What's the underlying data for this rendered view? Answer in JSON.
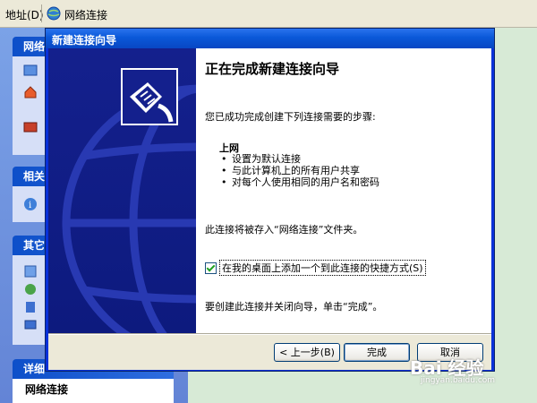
{
  "address_bar": {
    "label": "地址(D)",
    "value": "网络连接"
  },
  "task_pane": {
    "sections": [
      {
        "title": "网络"
      },
      {
        "title": "相关"
      },
      {
        "title": "其它"
      },
      {
        "title": "详细"
      }
    ],
    "details_value": "网络连接"
  },
  "wizard": {
    "title": "新建连接向导",
    "heading": "正在完成新建连接向导",
    "intro": "您已成功完成创建下列连接需要的步骤:",
    "connection_name": "上网",
    "bullets": [
      "设置为默认连接",
      "与此计算机上的所有用户共享",
      "对每个人使用相同的用户名和密码"
    ],
    "stored_text": "此连接将被存入“网络连接”文件夹。",
    "shortcut_checkbox": {
      "label": "在我的桌面上添加一个到此连接的快捷方式(S)",
      "checked": true
    },
    "finish_hint": "要创建此连接并关闭向导，单击“完成”。",
    "buttons": {
      "back": "< 上一步(B)",
      "finish": "完成",
      "cancel": "取消"
    }
  },
  "watermark": {
    "text": "Bai 经验",
    "url": "jingyan.baidu.com"
  },
  "colors": {
    "title_bar": "#0a58d8",
    "banner": "#14208d",
    "client": "#ece9d8",
    "background": "#d7ead6"
  }
}
